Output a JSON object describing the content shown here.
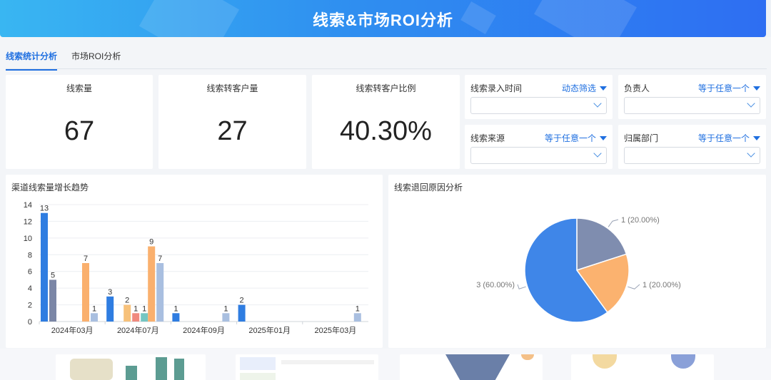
{
  "header": {
    "title": "线索&市场ROI分析"
  },
  "tabs": [
    {
      "label": "线索统计分析",
      "active": true
    },
    {
      "label": "市场ROI分析",
      "active": false
    }
  ],
  "kpis": [
    {
      "label": "线索量",
      "value": "67"
    },
    {
      "label": "线索转客户量",
      "value": "27"
    },
    {
      "label": "线索转客户比例",
      "value": "40.30%"
    }
  ],
  "filters": [
    {
      "label": "线索录入时间",
      "operator": "动态筛选",
      "value": ""
    },
    {
      "label": "负责人",
      "operator": "等于任意一个",
      "value": ""
    },
    {
      "label": "线索来源",
      "operator": "等于任意一个",
      "value": ""
    },
    {
      "label": "归属部门",
      "operator": "等于任意一个",
      "value": ""
    }
  ],
  "colors": {
    "accent": "#1f6fe0",
    "bar_series": [
      "#2f7de1",
      "#7b86a6",
      "#f7c17a",
      "#fab06e",
      "#f08a7e",
      "#74c6c3",
      "#a9bfe0"
    ],
    "pie": [
      "#3f86e8",
      "#fbb26f",
      "#7f8daf"
    ]
  },
  "chart_data": [
    {
      "title": "渠道线索量增长趋势",
      "type": "bar",
      "ylim": [
        0,
        14
      ],
      "yticks": [
        0,
        2,
        4,
        6,
        8,
        10,
        12,
        14
      ],
      "x_tick_labels": [
        "2024年03月",
        "2024年07月",
        "2024年09月",
        "2025年01月",
        "2025年03月"
      ],
      "grid": true,
      "groups": [
        {
          "bars": [
            {
              "v": 13,
              "c": 0
            },
            {
              "v": 5,
              "c": 1
            },
            {
              "v": 7,
              "c": 3
            },
            {
              "v": 1,
              "c": 6
            }
          ]
        },
        {
          "bars": [
            {
              "v": 3,
              "c": 0
            },
            {
              "v": 2,
              "c": 2
            },
            {
              "v": 1,
              "c": 4
            },
            {
              "v": 1,
              "c": 5
            },
            {
              "v": 9,
              "c": 3
            },
            {
              "v": 7,
              "c": 6
            }
          ]
        },
        {
          "bars": [
            {
              "v": 1,
              "c": 0
            },
            {
              "v": 1,
              "c": 6
            }
          ]
        },
        {
          "bars": [
            {
              "v": 2,
              "c": 0
            }
          ]
        },
        {
          "bars": [
            {
              "v": 1,
              "c": 6
            }
          ]
        }
      ]
    },
    {
      "title": "线索退回原因分析",
      "type": "pie",
      "slices": [
        {
          "value": 3,
          "label": "3 (60.00%)",
          "c": 0
        },
        {
          "value": 1,
          "label": "1 (20.00%)",
          "c": 1
        },
        {
          "value": 1,
          "label": "1 (20.00%)",
          "c": 2
        }
      ]
    }
  ]
}
